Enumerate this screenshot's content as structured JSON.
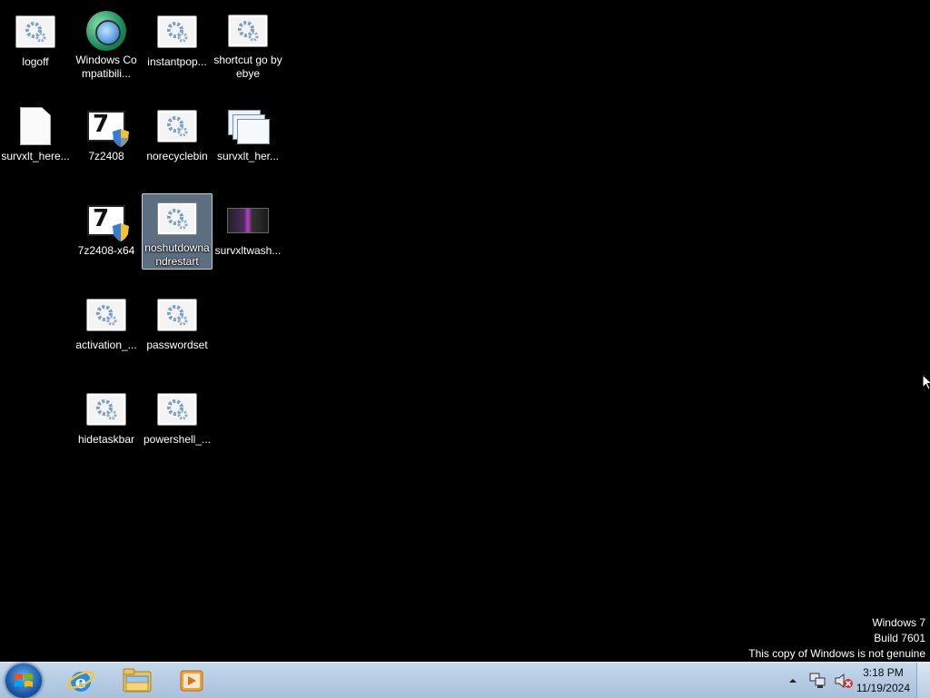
{
  "desktop": {
    "icons": [
      {
        "label": "logoff",
        "kind": "script-icon"
      },
      {
        "label": "Windows Compatibili...",
        "kind": "program-compatibility-icon"
      },
      {
        "label": "instantpop...",
        "kind": "script-icon"
      },
      {
        "label": "shortcut go byebye",
        "kind": "script-icon"
      },
      {
        "label": "survxlt_here...",
        "kind": "blank-file-icon"
      },
      {
        "label": "7z2408",
        "kind": "7zip-installer-icon"
      },
      {
        "label": "norecyclebin",
        "kind": "script-icon"
      },
      {
        "label": "survxlt_her...",
        "kind": "window-stack-icon"
      },
      {
        "label": "7z2408-x64",
        "kind": "7zip-installer-icon"
      },
      {
        "label": "noshutdownandrestart",
        "kind": "script-icon",
        "selected": true
      },
      {
        "label": "survxltwash...",
        "kind": "image-thumbnail-icon"
      },
      {
        "label": "activation_...",
        "kind": "script-icon"
      },
      {
        "label": "passwordset",
        "kind": "script-icon"
      },
      {
        "label": "hidetaskbar",
        "kind": "script-icon"
      },
      {
        "label": "powershell_...",
        "kind": "script-icon"
      }
    ]
  },
  "watermark": {
    "line1": "Windows 7",
    "line2": "Build 7601",
    "line3": "This copy of Windows is not genuine"
  },
  "taskbar": {
    "start_icon": "windows-logo-icon",
    "pinned": [
      "internet-explorer-icon",
      "windows-explorer-icon",
      "media-player-icon"
    ],
    "tray": {
      "icons": [
        "show-hidden-icons-chevron-icon",
        "network-icon",
        "volume-muted-icon"
      ],
      "time": "3:18 PM",
      "date": "11/19/2024"
    }
  },
  "colors": {
    "desktop_bg": "#000000",
    "taskbar_bg": "#b7cde4",
    "selection": "#9fbfe0"
  }
}
